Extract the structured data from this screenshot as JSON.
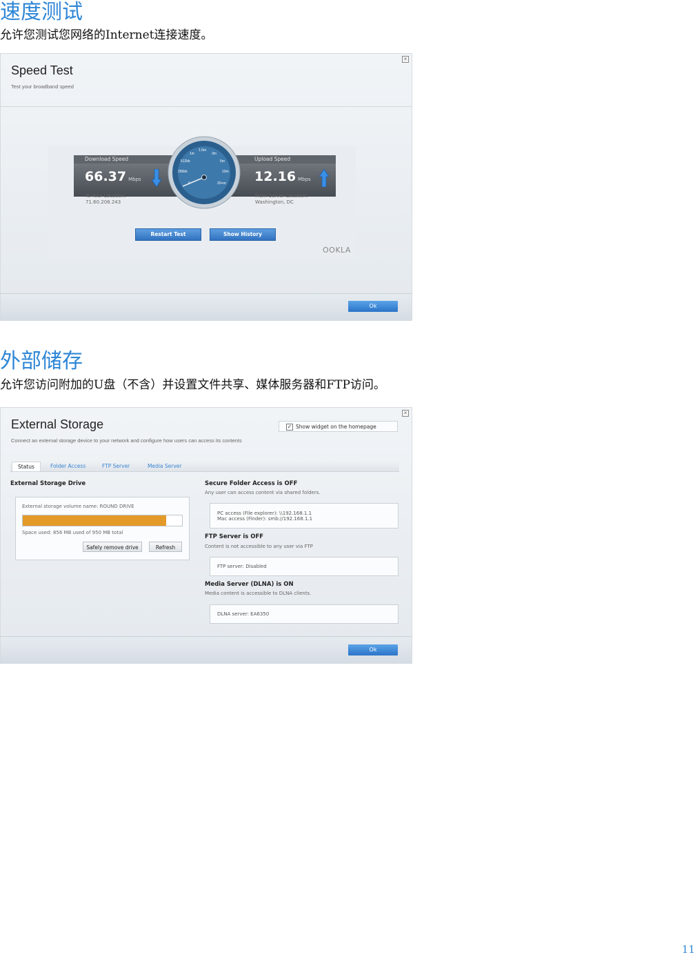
{
  "section1": {
    "heading": "速度测试",
    "description": "允许您测试您网络的Internet连接速度。"
  },
  "speed_test": {
    "title": "Speed Test",
    "subtitle": "Test your broadband speed",
    "download_label": "Download Speed",
    "download_value": "66.37",
    "download_unit": "Mbps",
    "upload_label": "Upload Speed",
    "upload_value": "12.16",
    "upload_unit": "Mbps",
    "to_location_label": "To Your Location:",
    "to_location_value": "71.60.208.243",
    "from_location_label": "From Server Location:",
    "from_location_value": "Washington, DC",
    "gauge_ticks": [
      "0",
      "256kb",
      "512kb",
      "1m",
      "1.5m",
      "3m",
      "5m",
      "10m",
      "20+m"
    ],
    "restart_button": "Restart Test",
    "history_button": "Show History",
    "brand": "OOKLA",
    "ok_button": "Ok",
    "colors": {
      "accent": "#3273c0",
      "arrow": "#3a8ee6"
    }
  },
  "section2": {
    "heading": "外部储存",
    "description": "允许您访问附加的U盘（不含）并设置文件共享、媒体服务器和FTP访问。"
  },
  "external_storage": {
    "title": "External Storage",
    "subtitle": "Connect an external storage device to your network and configure how users can access its contents",
    "widget_checkbox": "Show widget on the homepage",
    "widget_checked": true,
    "tabs": [
      "Status",
      "Folder Access",
      "FTP Server",
      "Media Server"
    ],
    "drive_heading": "External Storage Drive",
    "volume_name": "External storage volume name: ROUND DRIVE",
    "space_used": "Space used: 856 MB used of 950 MB total",
    "usage_fraction": 0.9,
    "safely_remove_button": "Safely remove drive",
    "refresh_button": "Refresh",
    "secure_heading": "Secure Folder Access is OFF",
    "secure_desc": "Any user can access content via shared folders.",
    "pc_access": "PC access (File explorer): \\\\192.168.1.1",
    "mac_access": "Mac access (Finder): smb://192.168.1.1",
    "ftp_heading": "FTP Server is OFF",
    "ftp_desc": "Content is not accessible to any user via FTP",
    "ftp_status": "FTP server: Disabled",
    "media_heading": "Media Server (DLNA) is ON",
    "media_desc": "Media content is accessible to DLNA clients.",
    "dlna_status": "DLNA server: EA6350",
    "ok_button": "Ok",
    "colors": {
      "usage_bar": "#e49a28"
    }
  },
  "page_number": "11"
}
